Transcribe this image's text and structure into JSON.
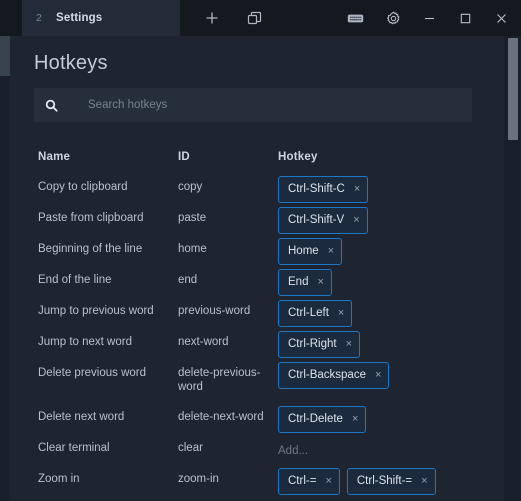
{
  "window": {
    "tab": {
      "index": "2",
      "title": "Settings"
    },
    "tabbar_actions": [
      {
        "name": "new-tab-button",
        "label": "+"
      },
      {
        "name": "duplicate-window-button",
        "label": ""
      }
    ],
    "controls": [
      {
        "name": "keyboard-button",
        "label": ""
      },
      {
        "name": "settings-gear-button",
        "label": ""
      },
      {
        "name": "minimize-button",
        "label": ""
      },
      {
        "name": "maximize-button",
        "label": ""
      },
      {
        "name": "close-button",
        "label": ""
      }
    ]
  },
  "page": {
    "title": "Hotkeys",
    "search": {
      "value": "",
      "placeholder": "Search hotkeys"
    },
    "table": {
      "headers": {
        "name": "Name",
        "id": "ID",
        "hotkey": "Hotkey"
      },
      "add_placeholder": "Add...",
      "rows": [
        {
          "name": "Copy to clipboard",
          "id": "copy",
          "hotkeys": [
            "Ctrl-Shift-C"
          ]
        },
        {
          "name": "Paste from clipboard",
          "id": "paste",
          "hotkeys": [
            "Ctrl-Shift-V"
          ]
        },
        {
          "name": "Beginning of the line",
          "id": "home",
          "hotkeys": [
            "Home"
          ]
        },
        {
          "name": "End of the line",
          "id": "end",
          "hotkeys": [
            "End"
          ]
        },
        {
          "name": "Jump to previous word",
          "id": "previous-word",
          "hotkeys": [
            "Ctrl-Left"
          ]
        },
        {
          "name": "Jump to next word",
          "id": "next-word",
          "hotkeys": [
            "Ctrl-Right"
          ]
        },
        {
          "name": "Delete previous word",
          "id": "delete-previous-word",
          "hotkeys": [
            "Ctrl-Backspace"
          ]
        },
        {
          "name": "Delete next word",
          "id": "delete-next-word",
          "hotkeys": [
            "Ctrl-Delete"
          ]
        },
        {
          "name": "Clear terminal",
          "id": "clear",
          "hotkeys": []
        },
        {
          "name": "Zoom in",
          "id": "zoom-in",
          "hotkeys": [
            "Ctrl-=",
            "Ctrl-Shift-="
          ]
        }
      ]
    }
  },
  "colors": {
    "background": "#1e2430",
    "titlebar": "#14181f",
    "tab_active": "#232b39",
    "accent_blue": "#1d77c8",
    "chip_fill": "#1b2b3d",
    "scrollbar_thumb": "#6a7280"
  }
}
